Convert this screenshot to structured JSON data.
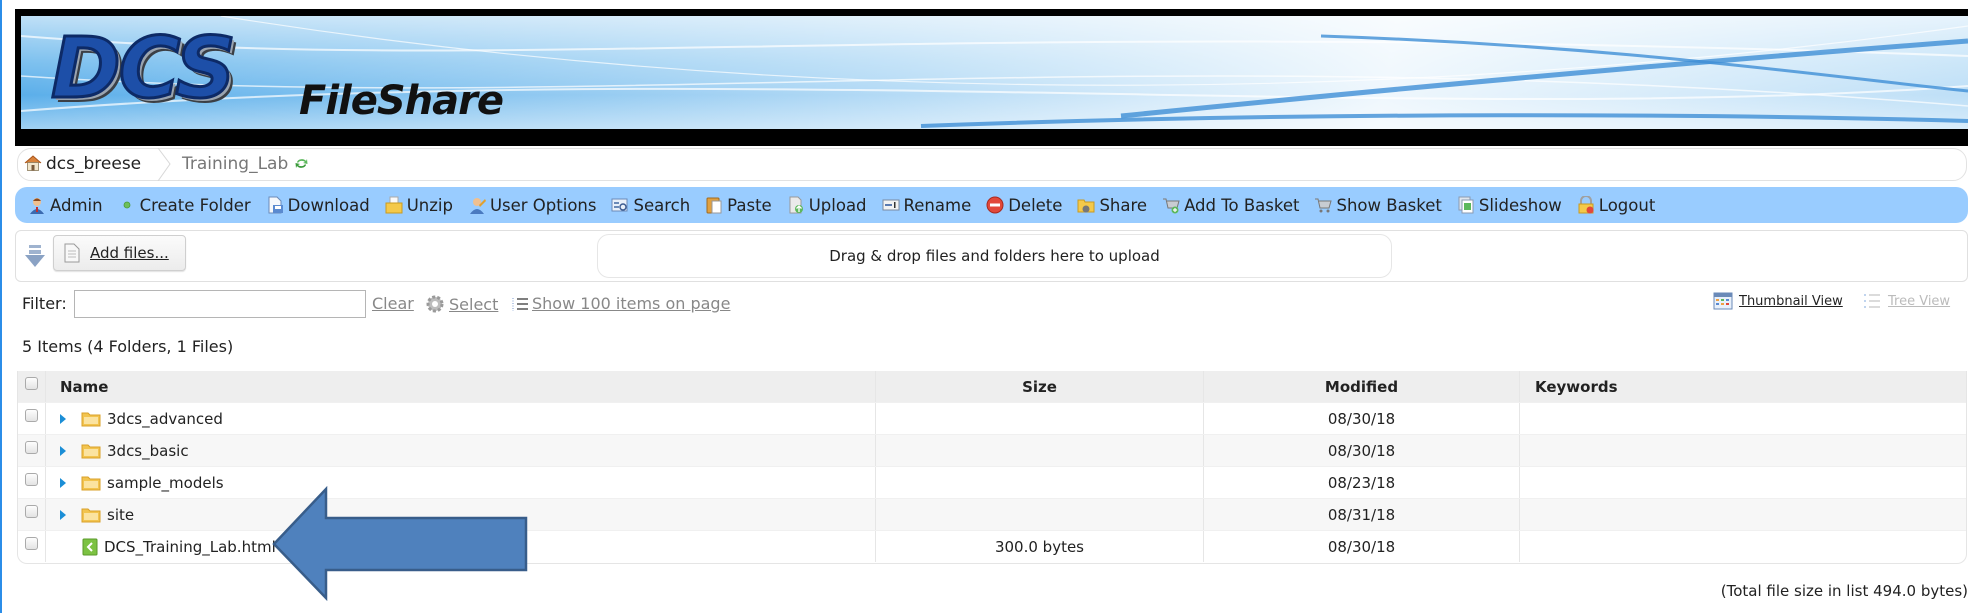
{
  "app": {
    "logo_main": "DCS",
    "logo_sub": "FileShare"
  },
  "breadcrumb": {
    "home_label": "dcs_breese",
    "current_label": "Training_Lab",
    "home_icon": "home-icon",
    "refresh_icon": "refresh-icon"
  },
  "toolbar": {
    "items": [
      {
        "label": "Admin",
        "icon": "admin-user-icon"
      },
      {
        "label": "Create Folder",
        "icon": "create-folder-dot-icon"
      },
      {
        "label": "Download",
        "icon": "download-icon"
      },
      {
        "label": "Unzip",
        "icon": "unzip-icon"
      },
      {
        "label": "User Options",
        "icon": "user-options-icon"
      },
      {
        "label": "Search",
        "icon": "search-icon"
      },
      {
        "label": "Paste",
        "icon": "paste-icon"
      },
      {
        "label": "Upload",
        "icon": "upload-icon"
      },
      {
        "label": "Rename",
        "icon": "rename-icon"
      },
      {
        "label": "Delete",
        "icon": "delete-icon"
      },
      {
        "label": "Share",
        "icon": "share-icon"
      },
      {
        "label": "Add To Basket",
        "icon": "add-to-basket-icon"
      },
      {
        "label": "Show Basket",
        "icon": "basket-icon"
      },
      {
        "label": "Slideshow",
        "icon": "slideshow-icon"
      },
      {
        "label": "Logout",
        "icon": "lock-icon"
      }
    ]
  },
  "upload": {
    "add_files_label": "Add files...",
    "dropzone_text": "Drag & drop files and folders here to upload"
  },
  "filter": {
    "label": "Filter:",
    "value": "",
    "placeholder": "",
    "clear_label": "Clear",
    "select_label": "Select",
    "show_items_label": "Show 100 items on page"
  },
  "views": {
    "thumbnail_label": "Thumbnail View",
    "tree_label": "Tree View"
  },
  "summary": {
    "items_count": "5 Items (4 Folders, 1 Files)",
    "total_size": "(Total file size in list 494.0 bytes)"
  },
  "colors": {
    "toolbar_bg": "#99ccff",
    "arrow_fill": "#4f81bd",
    "arrow_stroke": "#385d8a",
    "expander": "#1b8ed6"
  },
  "table": {
    "columns": [
      "Name",
      "Size",
      "Modified",
      "Keywords"
    ],
    "rows": [
      {
        "type": "folder",
        "name": "3dcs_advanced",
        "size": "",
        "modified": "08/30/18",
        "keywords": ""
      },
      {
        "type": "folder",
        "name": "3dcs_basic",
        "size": "",
        "modified": "08/30/18",
        "keywords": ""
      },
      {
        "type": "folder",
        "name": "sample_models",
        "size": "",
        "modified": "08/23/18",
        "keywords": ""
      },
      {
        "type": "folder",
        "name": "site",
        "size": "",
        "modified": "08/31/18",
        "keywords": ""
      },
      {
        "type": "file",
        "name": "DCS_Training_Lab.html",
        "size": "300.0 bytes",
        "modified": "08/30/18",
        "keywords": ""
      }
    ]
  },
  "annotation": {
    "type": "arrow",
    "points_to": "DCS_Training_Lab.html"
  }
}
